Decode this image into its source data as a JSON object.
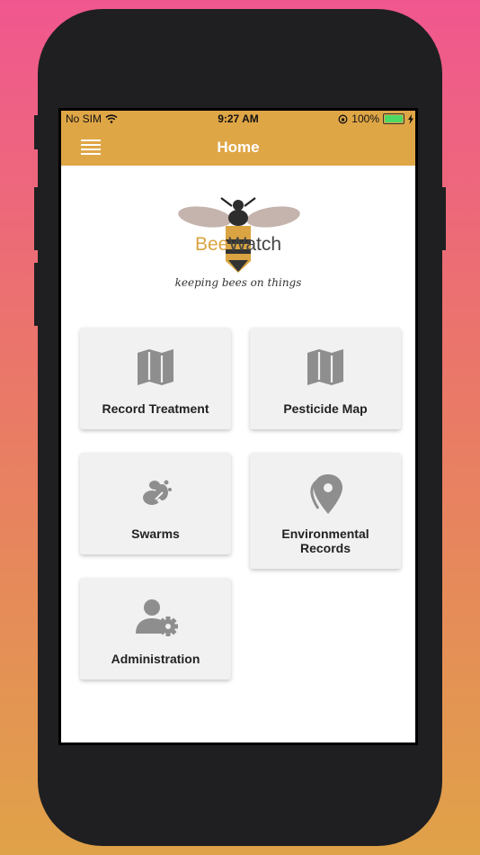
{
  "status_bar": {
    "carrier": "No SIM",
    "time": "9:27 AM",
    "battery": "100%"
  },
  "header": {
    "title": "Home"
  },
  "logo": {
    "brand_prefix": "Bee",
    "brand_suffix": "Watch",
    "tagline": "keeping bees on things"
  },
  "tiles": [
    {
      "label": "Record Treatment",
      "icon": "map-icon"
    },
    {
      "label": "Pesticide Map",
      "icon": "map-icon"
    },
    {
      "label": "Swarms",
      "icon": "swarm-icon"
    },
    {
      "label": "Environmental Records",
      "icon": "map-marker-icon"
    },
    {
      "label": "Administration",
      "icon": "user-cog-icon"
    }
  ],
  "colors": {
    "accent": "#dfa646",
    "tile_bg": "#f1f1f1",
    "icon": "#8e8e8e"
  }
}
